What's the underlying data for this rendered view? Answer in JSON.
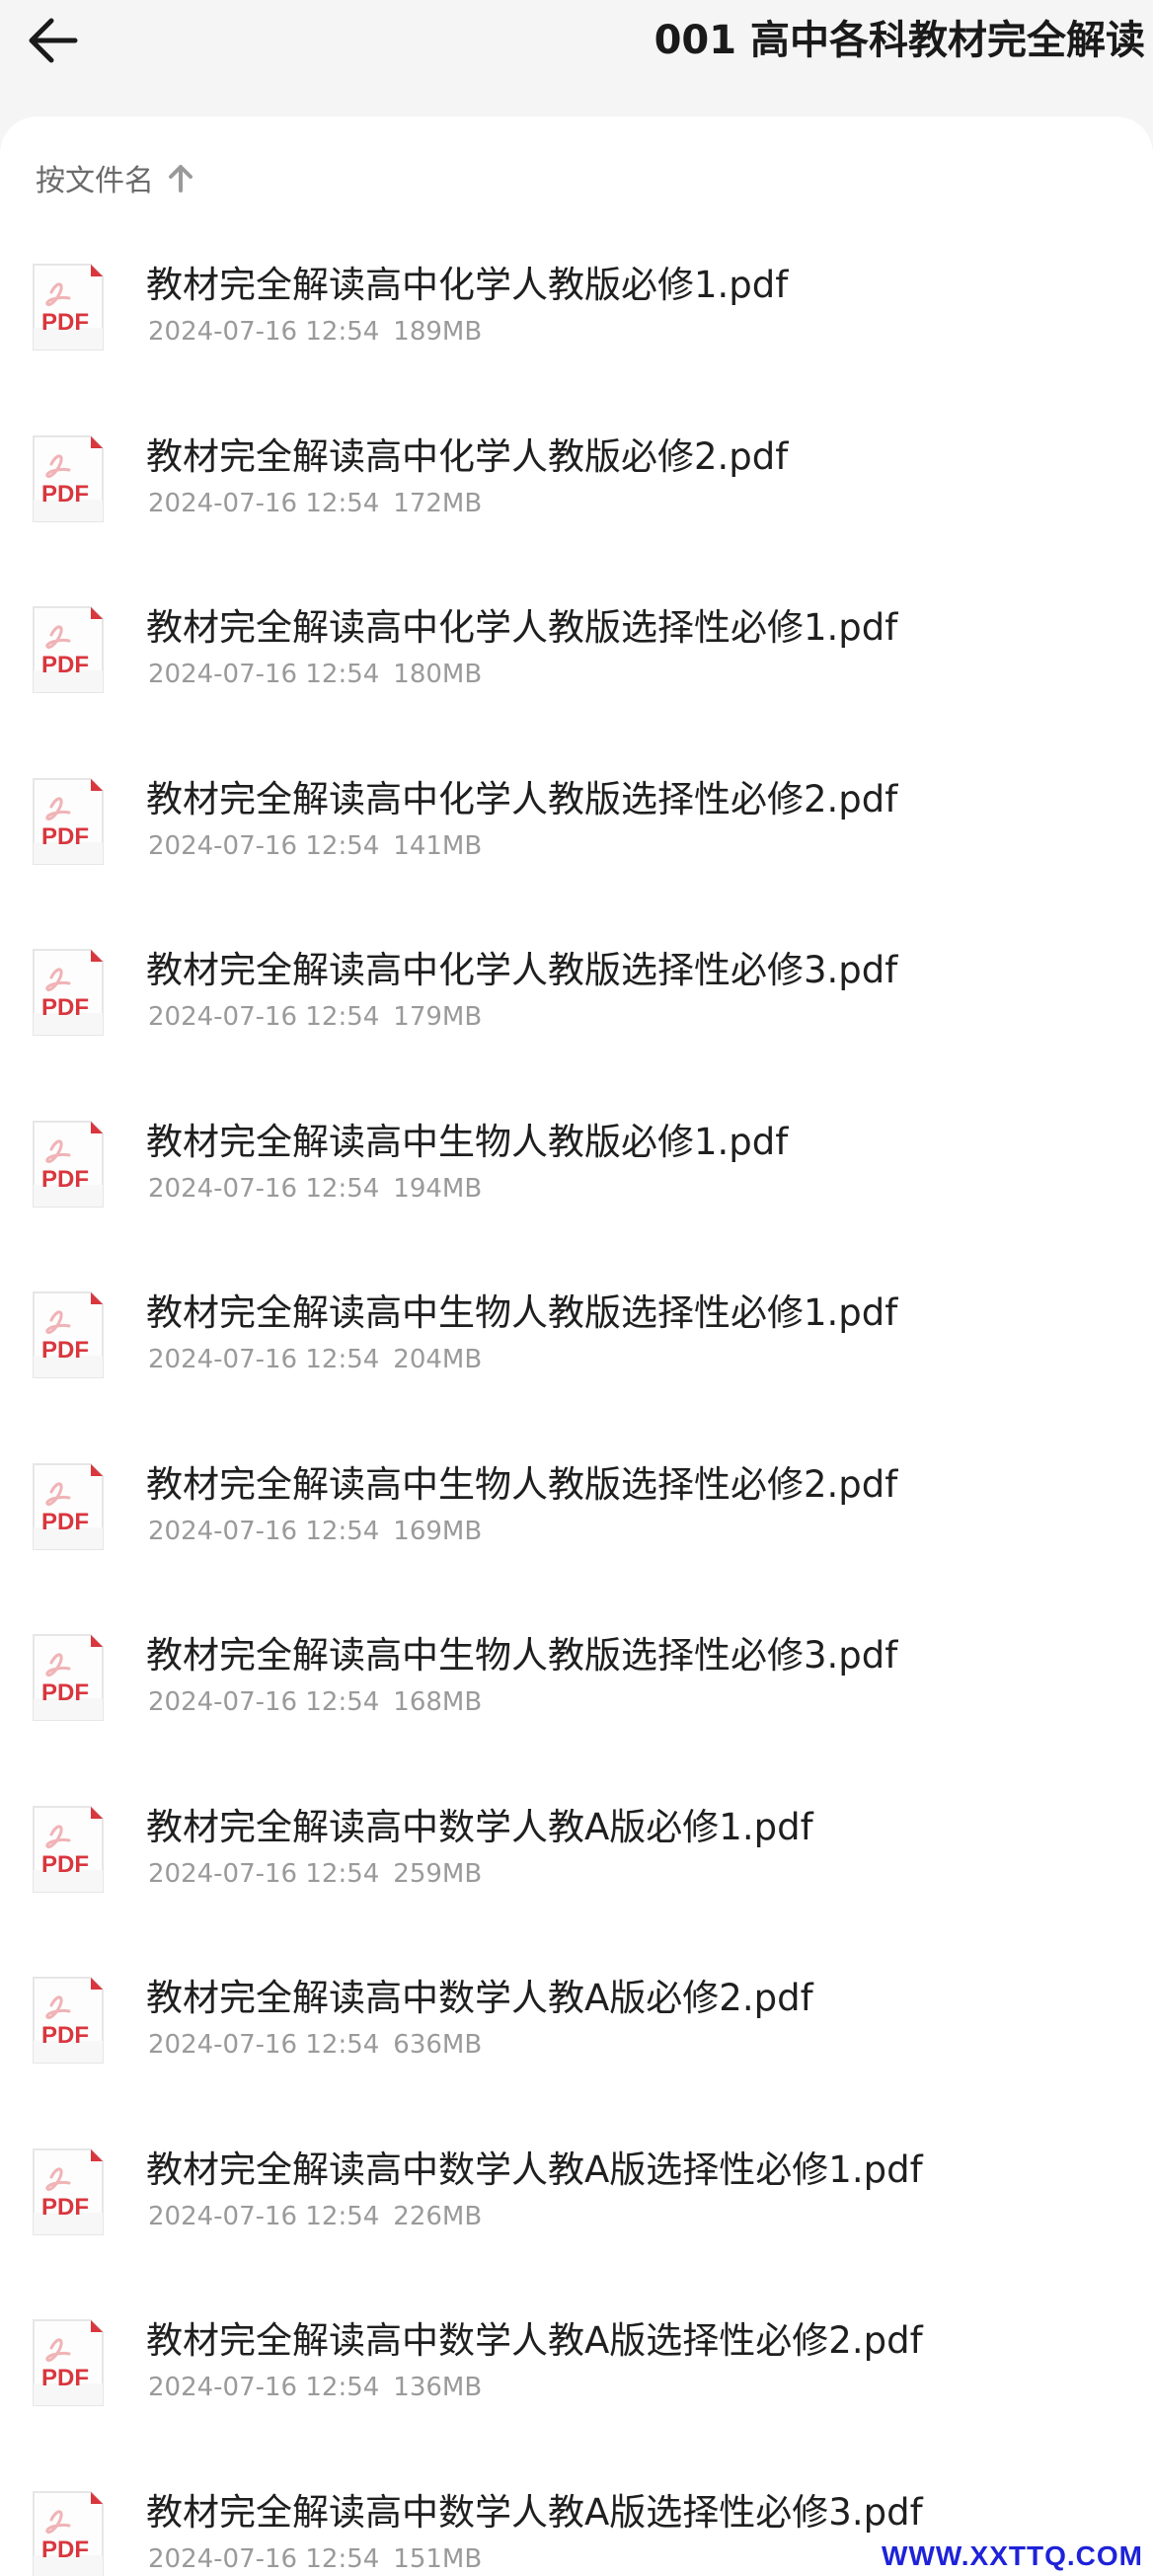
{
  "header": {
    "title": "001 高中各科教材完全解读",
    "back_icon": "arrow-left-icon"
  },
  "sort": {
    "label": "按文件名",
    "direction_icon": "arrow-up-icon"
  },
  "files": [
    {
      "name": "教材完全解读高中化学人教版必修1.pdf",
      "date": "2024-07-16 12:54",
      "size": "189MB"
    },
    {
      "name": "教材完全解读高中化学人教版必修2.pdf",
      "date": "2024-07-16 12:54",
      "size": "172MB"
    },
    {
      "name": "教材完全解读高中化学人教版选择性必修1.pdf",
      "date": "2024-07-16 12:54",
      "size": "180MB"
    },
    {
      "name": "教材完全解读高中化学人教版选择性必修2.pdf",
      "date": "2024-07-16 12:54",
      "size": "141MB"
    },
    {
      "name": "教材完全解读高中化学人教版选择性必修3.pdf",
      "date": "2024-07-16 12:54",
      "size": "179MB"
    },
    {
      "name": "教材完全解读高中生物人教版必修1.pdf",
      "date": "2024-07-16 12:54",
      "size": "194MB"
    },
    {
      "name": "教材完全解读高中生物人教版选择性必修1.pdf",
      "date": "2024-07-16 12:54",
      "size": "204MB"
    },
    {
      "name": "教材完全解读高中生物人教版选择性必修2.pdf",
      "date": "2024-07-16 12:54",
      "size": "169MB"
    },
    {
      "name": "教材完全解读高中生物人教版选择性必修3.pdf",
      "date": "2024-07-16 12:54",
      "size": "168MB"
    },
    {
      "name": "教材完全解读高中数学人教A版必修1.pdf",
      "date": "2024-07-16 12:54",
      "size": "259MB"
    },
    {
      "name": "教材完全解读高中数学人教A版必修2.pdf",
      "date": "2024-07-16 12:54",
      "size": "636MB"
    },
    {
      "name": "教材完全解读高中数学人教A版选择性必修1.pdf",
      "date": "2024-07-16 12:54",
      "size": "226MB"
    },
    {
      "name": "教材完全解读高中数学人教A版选择性必修2.pdf",
      "date": "2024-07-16 12:54",
      "size": "136MB"
    },
    {
      "name": "教材完全解读高中数学人教A版选择性必修3.pdf",
      "date": "2024-07-16 12:54",
      "size": "151MB"
    }
  ],
  "file_icon": {
    "name": "pdf-file-icon",
    "label": "PDF",
    "color": "#d9363e"
  },
  "watermark": "WWW.XXTTQ.COM",
  "colors": {
    "header_bg": "#f5f5f5",
    "content_bg": "#ffffff",
    "watermark": "#1e22d8"
  }
}
